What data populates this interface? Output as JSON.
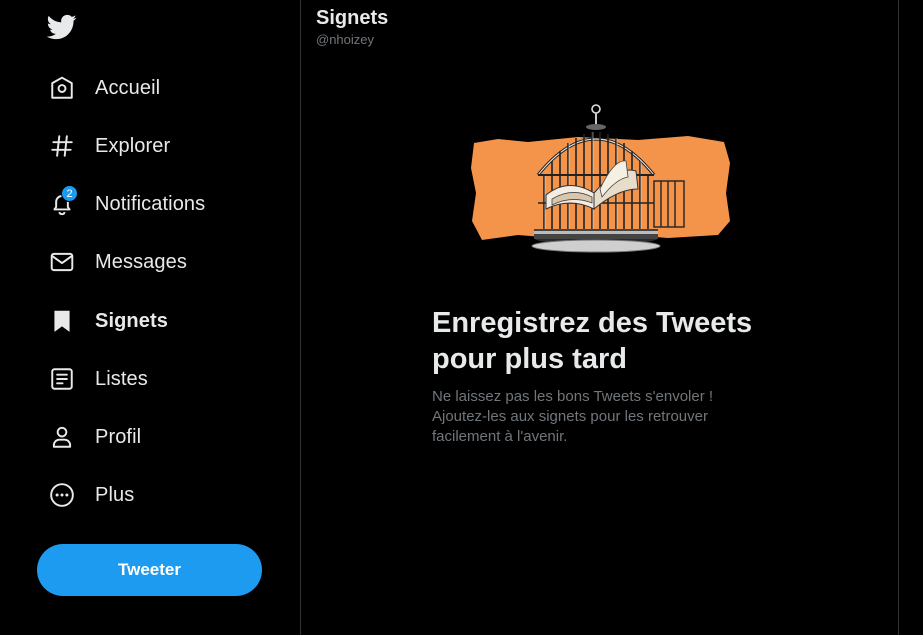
{
  "sidebar": {
    "logo_icon": "twitter-bird-icon",
    "items": [
      {
        "label": "Accueil",
        "icon": "home-icon"
      },
      {
        "label": "Explorer",
        "icon": "hashtag-icon"
      },
      {
        "label": "Notifications",
        "icon": "bell-icon",
        "badge": "2"
      },
      {
        "label": "Messages",
        "icon": "envelope-icon"
      },
      {
        "label": "Signets",
        "icon": "bookmark-icon",
        "active": true
      },
      {
        "label": "Listes",
        "icon": "list-icon"
      },
      {
        "label": "Profil",
        "icon": "person-icon"
      },
      {
        "label": "Plus",
        "icon": "more-circle-icon"
      }
    ],
    "tweet_button": "Tweeter"
  },
  "header": {
    "title": "Signets",
    "handle": "@nhoizey"
  },
  "empty_state": {
    "title": "Enregistrez des Tweets pour plus tard",
    "description": "Ne laissez pas les bons Tweets s'envoler ! Ajoutez-les aux signets pour les retrouver facilement à l'avenir."
  },
  "colors": {
    "background": "#000000",
    "accent": "#1d9bf0",
    "text": "#e7e9ea",
    "muted": "#71767b",
    "illustration_orange": "#f4934a"
  }
}
